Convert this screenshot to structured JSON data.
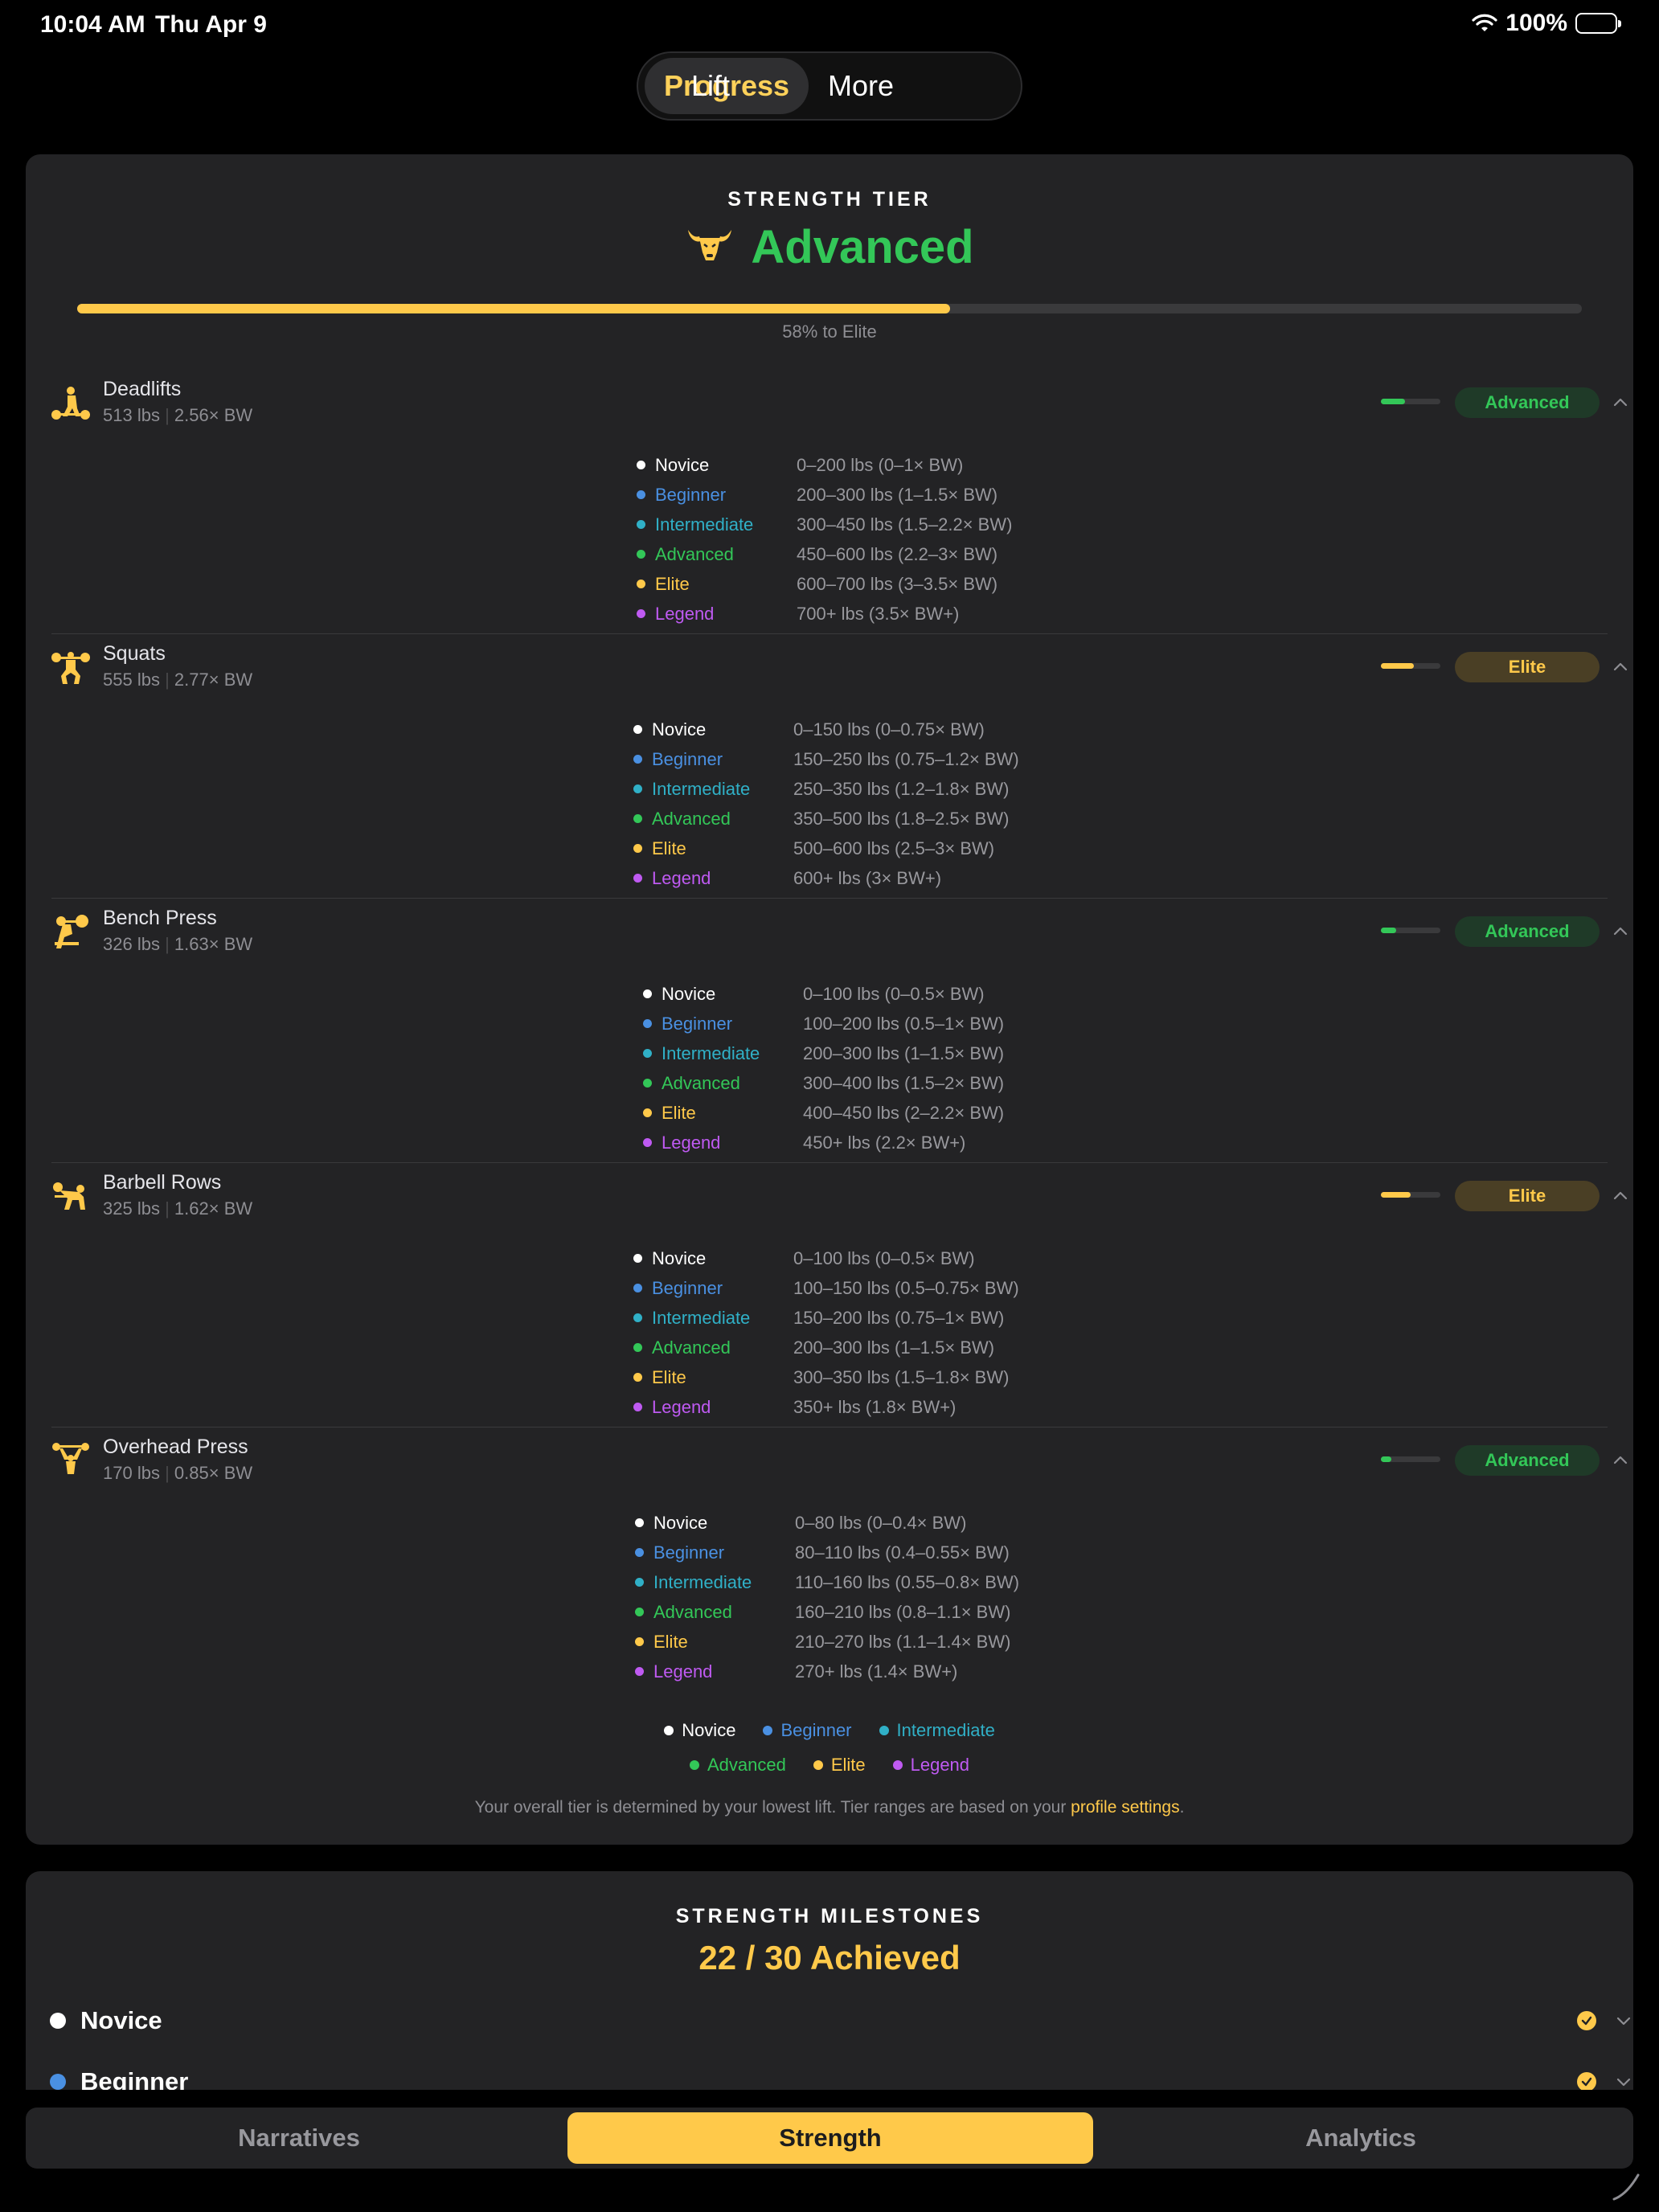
{
  "status_bar": {
    "time": "10:04 AM",
    "date": "Thu Apr 9",
    "battery": "100%"
  },
  "top_nav": {
    "tabs": [
      "Progress",
      "Lift",
      "More"
    ],
    "active": "Progress"
  },
  "colors": {
    "novice": "#ffffff",
    "beginner": "#4a90e2",
    "intermediate": "#30b0c7",
    "advanced": "#33c758",
    "elite": "#ffc94a",
    "legend": "#bf5af2"
  },
  "strength_tier": {
    "kicker": "STRENGTH TIER",
    "tier": "Advanced",
    "tier_icon": "bull-head-icon",
    "progress_fraction": 0.58,
    "progress_label": "58% to Elite",
    "lifts": [
      {
        "name": "Deadlifts",
        "weight": "513 lbs",
        "bw": "2.56× BW",
        "icon": "deadlift-icon",
        "badge": "Advanced",
        "level_fraction": 0.4,
        "ranges": [
          {
            "tier": "Novice",
            "range": "0–200 lbs (0–1× BW)"
          },
          {
            "tier": "Beginner",
            "range": "200–300 lbs (1–1.5× BW)"
          },
          {
            "tier": "Intermediate",
            "range": "300–450 lbs (1.5–2.2× BW)"
          },
          {
            "tier": "Advanced",
            "range": "450–600 lbs (2.2–3× BW)"
          },
          {
            "tier": "Elite",
            "range": "600–700 lbs (3–3.5× BW)"
          },
          {
            "tier": "Legend",
            "range": "700+ lbs (3.5× BW+)"
          }
        ]
      },
      {
        "name": "Squats",
        "weight": "555 lbs",
        "bw": "2.77× BW",
        "icon": "squat-icon",
        "badge": "Elite",
        "level_fraction": 0.55,
        "ranges": [
          {
            "tier": "Novice",
            "range": "0–150 lbs (0–0.75× BW)"
          },
          {
            "tier": "Beginner",
            "range": "150–250 lbs (0.75–1.2× BW)"
          },
          {
            "tier": "Intermediate",
            "range": "250–350 lbs (1.2–1.8× BW)"
          },
          {
            "tier": "Advanced",
            "range": "350–500 lbs (1.8–2.5× BW)"
          },
          {
            "tier": "Elite",
            "range": "500–600 lbs (2.5–3× BW)"
          },
          {
            "tier": "Legend",
            "range": "600+ lbs (3× BW+)"
          }
        ]
      },
      {
        "name": "Bench Press",
        "weight": "326 lbs",
        "bw": "1.63× BW",
        "icon": "bench-press-icon",
        "badge": "Advanced",
        "level_fraction": 0.26,
        "ranges": [
          {
            "tier": "Novice",
            "range": "0–100 lbs (0–0.5× BW)"
          },
          {
            "tier": "Beginner",
            "range": "100–200 lbs (0.5–1× BW)"
          },
          {
            "tier": "Intermediate",
            "range": "200–300 lbs (1–1.5× BW)"
          },
          {
            "tier": "Advanced",
            "range": "300–400 lbs (1.5–2× BW)"
          },
          {
            "tier": "Elite",
            "range": "400–450 lbs (2–2.2× BW)"
          },
          {
            "tier": "Legend",
            "range": "450+ lbs (2.2× BW+)"
          }
        ]
      },
      {
        "name": "Barbell Rows",
        "weight": "325 lbs",
        "bw": "1.62× BW",
        "icon": "barbell-row-icon",
        "badge": "Elite",
        "level_fraction": 0.5,
        "ranges": [
          {
            "tier": "Novice",
            "range": "0–100 lbs (0–0.5× BW)"
          },
          {
            "tier": "Beginner",
            "range": "100–150 lbs (0.5–0.75× BW)"
          },
          {
            "tier": "Intermediate",
            "range": "150–200 lbs (0.75–1× BW)"
          },
          {
            "tier": "Advanced",
            "range": "200–300 lbs (1–1.5× BW)"
          },
          {
            "tier": "Elite",
            "range": "300–350 lbs (1.5–1.8× BW)"
          },
          {
            "tier": "Legend",
            "range": "350+ lbs (1.8× BW+)"
          }
        ]
      },
      {
        "name": "Overhead Press",
        "weight": "170 lbs",
        "bw": "0.85× BW",
        "icon": "overhead-press-icon",
        "badge": "Advanced",
        "level_fraction": 0.18,
        "ranges": [
          {
            "tier": "Novice",
            "range": "0–80 lbs (0–0.4× BW)"
          },
          {
            "tier": "Beginner",
            "range": "80–110 lbs (0.4–0.55× BW)"
          },
          {
            "tier": "Intermediate",
            "range": "110–160 lbs (0.55–0.8× BW)"
          },
          {
            "tier": "Advanced",
            "range": "160–210 lbs (0.8–1.1× BW)"
          },
          {
            "tier": "Elite",
            "range": "210–270 lbs (1.1–1.4× BW)"
          },
          {
            "tier": "Legend",
            "range": "270+ lbs (1.4× BW+)"
          }
        ]
      }
    ],
    "legend": [
      "Novice",
      "Beginner",
      "Intermediate",
      "Advanced",
      "Elite",
      "Legend"
    ],
    "footnote": "Your overall tier is determined by your lowest lift. Tier ranges are based on your ",
    "footnote_link": "profile settings",
    "footnote_end": "."
  },
  "milestones": {
    "kicker": "STRENGTH MILESTONES",
    "count": "22 / 30 Achieved",
    "rows": [
      {
        "label": "Novice",
        "achieved": true
      },
      {
        "label": "Beginner",
        "achieved": true
      }
    ]
  },
  "bottom_tabs": {
    "tabs": [
      "Narratives",
      "Strength",
      "Analytics"
    ],
    "active": "Strength"
  }
}
